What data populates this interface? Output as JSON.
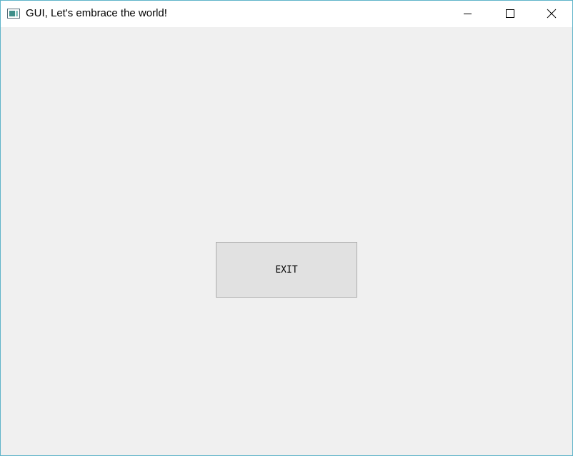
{
  "window": {
    "title": "GUI, Let's embrace the world!",
    "controls": {
      "minimize_icon": "minimize-icon",
      "maximize_icon": "maximize-icon",
      "close_icon": "close-icon"
    },
    "border_color": "#5fb4c9",
    "background_color": "#f0f0f0"
  },
  "main": {
    "exit_button_label": "EXIT"
  }
}
